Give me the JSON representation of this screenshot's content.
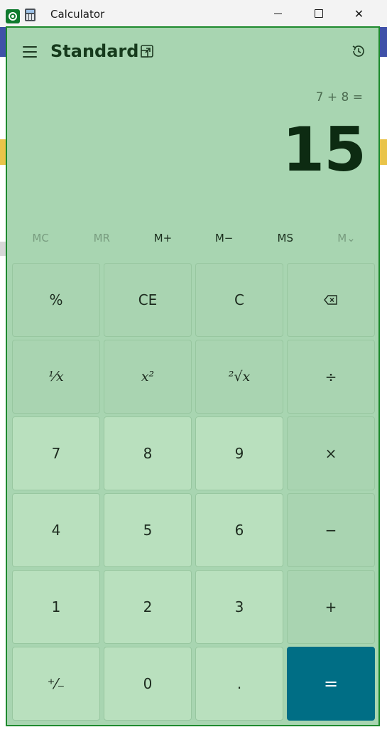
{
  "window": {
    "title": "Calculator",
    "minimize_icon": "minimize-icon",
    "maximize_icon": "maximize-icon",
    "close_label": "✕"
  },
  "header": {
    "mode": "Standard",
    "menu_icon": "hamburger-icon",
    "keep_on_top_icon": "keep-on-top-icon",
    "history_icon": "history-icon"
  },
  "display": {
    "expression": "7 + 8 =",
    "result": "15"
  },
  "memory": [
    {
      "label": "MC",
      "enabled": false
    },
    {
      "label": "MR",
      "enabled": false
    },
    {
      "label": "M+",
      "enabled": true
    },
    {
      "label": "M−",
      "enabled": true
    },
    {
      "label": "MS",
      "enabled": true
    },
    {
      "label": "M⌄",
      "enabled": false
    }
  ],
  "keys": {
    "percent": "%",
    "clear_entry": "CE",
    "clear": "C",
    "backspace": "⌫",
    "reciprocal": "¹⁄x",
    "square": "x²",
    "sqrt": "²√x",
    "divide": "÷",
    "seven": "7",
    "eight": "8",
    "nine": "9",
    "multiply": "×",
    "four": "4",
    "five": "5",
    "six": "6",
    "minus": "−",
    "one": "1",
    "two": "2",
    "three": "3",
    "plus": "+",
    "negate": "⁺⁄₋",
    "zero": "0",
    "decimal": ".",
    "equals": "="
  },
  "colors": {
    "body": "#a8d5b1",
    "border": "#1e8a2e",
    "equals": "#006e85"
  }
}
